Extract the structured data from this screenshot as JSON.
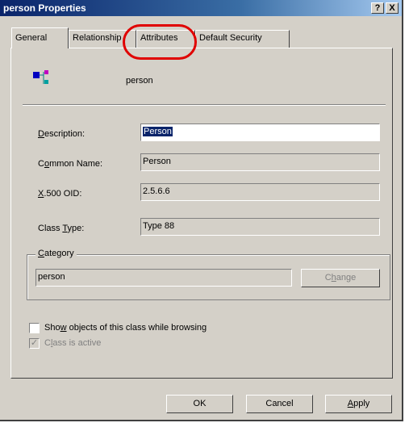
{
  "window": {
    "title": "person Properties",
    "help_button": "?",
    "close_button": "X"
  },
  "tabs": [
    "General",
    "Relationship",
    "Attributes",
    "Default Security"
  ],
  "header": {
    "object_name": "person"
  },
  "fields": {
    "description": {
      "label": "Description:",
      "value": "Person"
    },
    "common_name": {
      "label": "Common Name:",
      "value": "Person"
    },
    "x500_oid": {
      "label": "X.500 OID:",
      "value": "2.5.6.6"
    },
    "class_type": {
      "label": "Class Type:",
      "value": "Type 88"
    }
  },
  "category": {
    "label": "Category",
    "value": "person",
    "change_button": "Change"
  },
  "checkboxes": {
    "show_objects": {
      "label": "Show objects of this class while browsing",
      "checked": false
    },
    "class_active": {
      "label": "Class is active",
      "checked": true
    }
  },
  "buttons": {
    "ok": "OK",
    "cancel": "Cancel",
    "apply": "Apply"
  },
  "colors": {
    "title_bar": "#0a246a",
    "highlight_circle": "#e00000",
    "dialog_face": "#d4d0c8"
  }
}
